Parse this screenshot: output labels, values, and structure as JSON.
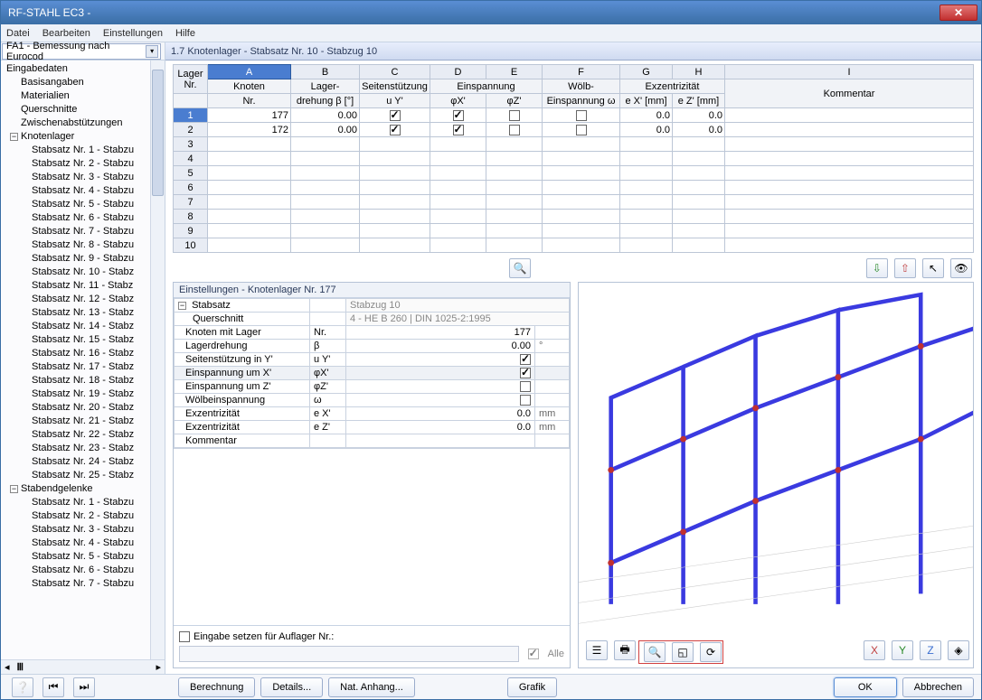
{
  "window": {
    "title": "RF-STAHL EC3 -"
  },
  "menu": {
    "file": "Datei",
    "edit": "Bearbeiten",
    "settings": "Einstellungen",
    "help": "Hilfe"
  },
  "combo": {
    "label": "FA1 - Bemessung nach Eurocod"
  },
  "tab": {
    "title": "1.7 Knotenlager - Stabsatz Nr. 10 - Stabzug 10"
  },
  "tree": {
    "root": "Eingabedaten",
    "items": [
      "Basisangaben",
      "Materialien",
      "Querschnitte",
      "Zwischenabstützungen"
    ],
    "knotenlager": "Knotenlager",
    "stabsatz_prefix": "Stabsatz Nr. ",
    "stabsatz_suffix": " - Stabzu",
    "stabsatz_suffix_short": " - Stabz",
    "stabendgelenke": "Stabendgelenke"
  },
  "grid": {
    "colLetters": [
      "A",
      "B",
      "C",
      "D",
      "E",
      "F",
      "G",
      "H",
      "I"
    ],
    "h_lager": "Lager",
    "h_nr": "Nr.",
    "h_knoten": "Knoten",
    "h_knoten2": "Nr.",
    "h_lagerdreh": "Lager-",
    "h_lagerdreh2": "drehung β [°]",
    "h_seiten": "Seitenstützung",
    "h_seiten2": "u Y'",
    "h_einsp": "Einspannung",
    "h_einsp_x": "φX'",
    "h_einsp_z": "φZ'",
    "h_wolb": "Wölb-",
    "h_wolb2": "Einspannung ω",
    "h_exz": "Exzentrizität",
    "h_ex": "e X' [mm]",
    "h_ez": "e Z' [mm]",
    "h_komm": "Kommentar",
    "rows": [
      {
        "n": "1",
        "knoten": "177",
        "dreh": "0.00",
        "uy": true,
        "fx": true,
        "fz": false,
        "wo": false,
        "ex": "0.0",
        "ez": "0.0"
      },
      {
        "n": "2",
        "knoten": "172",
        "dreh": "0.00",
        "uy": true,
        "fx": true,
        "fz": false,
        "wo": false,
        "ex": "0.0",
        "ez": "0.0"
      }
    ]
  },
  "settings": {
    "title": "Einstellungen - Knotenlager Nr. 177",
    "rows": {
      "stabsatz": {
        "lbl": "Stabsatz",
        "val": "Stabzug 10"
      },
      "quer": {
        "lbl": "Querschnitt",
        "val": "4 - HE B 260 | DIN 1025-2:1995"
      },
      "knoten": {
        "lbl": "Knoten mit Lager",
        "sym": "Nr.",
        "val": "177"
      },
      "lagerdreh": {
        "lbl": "Lagerdrehung",
        "sym": "β",
        "val": "0.00",
        "unit": "°"
      },
      "seiten": {
        "lbl": "Seitenstützung in Y'",
        "sym": "u Y'",
        "chk": true
      },
      "einspx": {
        "lbl": "Einspannung um X'",
        "sym": "φX'",
        "chk": true
      },
      "einspz": {
        "lbl": "Einspannung um Z'",
        "sym": "φZ'",
        "chk": false
      },
      "wolb": {
        "lbl": "Wölbeinspannung",
        "sym": "ω",
        "chk": false
      },
      "exx": {
        "lbl": "Exzentrizität",
        "sym": "e X'",
        "val": "0.0",
        "unit": "mm"
      },
      "exz": {
        "lbl": "Exzentrizität",
        "sym": "e Z'",
        "val": "0.0",
        "unit": "mm"
      },
      "komm": {
        "lbl": "Kommentar"
      }
    },
    "foot_check": "Eingabe setzen für Auflager Nr.:",
    "foot_all": "Alle"
  },
  "buttons": {
    "berechnung": "Berechnung",
    "details": "Details...",
    "anhang": "Nat. Anhang...",
    "grafik": "Grafik",
    "ok": "OK",
    "abbrechen": "Abbrechen"
  }
}
